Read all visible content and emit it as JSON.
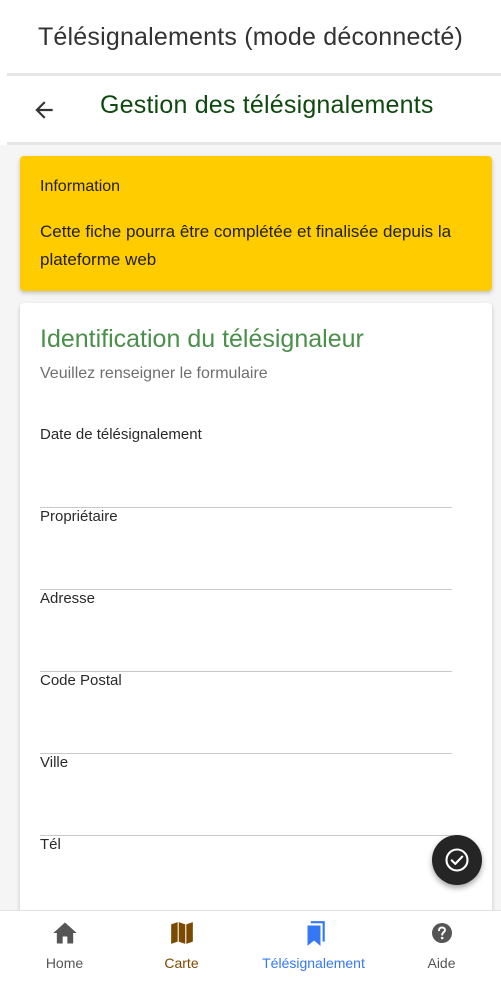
{
  "app": {
    "title": "Télésignalements (mode déconnecté)"
  },
  "header": {
    "title": "Gestion des télésignalements",
    "back_icon": "arrow-left-icon"
  },
  "info_card": {
    "title": "Information",
    "text": "Cette fiche pourra être complétée et finalisée depuis la plateforme web",
    "color": "#ffcc00"
  },
  "form": {
    "title": "Identification du télésignaleur",
    "subtitle": "Veuillez renseigner le formulaire",
    "fields": [
      {
        "label": "Date de télésignalement",
        "value": ""
      },
      {
        "label": "Propriétaire",
        "value": ""
      },
      {
        "label": "Adresse",
        "value": ""
      },
      {
        "label": "Code Postal",
        "value": ""
      },
      {
        "label": "Ville",
        "value": ""
      },
      {
        "label": "Tél",
        "value": ""
      }
    ]
  },
  "fab": {
    "icon": "check-circle-icon"
  },
  "bottom_nav": {
    "items": [
      {
        "label": "Home",
        "icon": "home-icon",
        "color": "#555555"
      },
      {
        "label": "Carte",
        "icon": "map-icon",
        "color": "#7a4a00"
      },
      {
        "label": "Télésignalement",
        "icon": "bookmark-icon",
        "color": "#3478f6",
        "active": true
      },
      {
        "label": "Aide",
        "icon": "help-icon",
        "color": "#555555"
      }
    ]
  },
  "colors": {
    "header_title": "#0e4a0e",
    "form_title": "#4a8f4a",
    "active_tab": "#3478f6"
  }
}
